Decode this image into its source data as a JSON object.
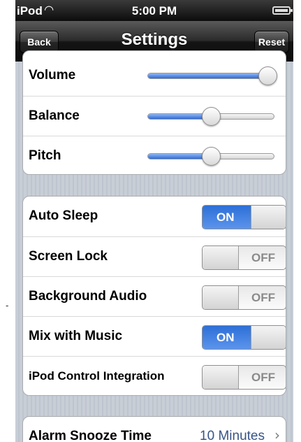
{
  "statusbar": {
    "carrier": "iPod",
    "time": "5:00 PM",
    "wifi_icon": "wifi-icon",
    "battery_icon": "battery-icon"
  },
  "navbar": {
    "title": "Settings",
    "back_label": "Back",
    "reset_label": "Reset"
  },
  "outside_mark": "-",
  "sliders": [
    {
      "label": "Volume",
      "value": 0.95
    },
    {
      "label": "Balance",
      "value": 0.5
    },
    {
      "label": "Pitch",
      "value": 0.5
    }
  ],
  "switches": [
    {
      "label": "Auto Sleep",
      "state": "ON"
    },
    {
      "label": "Screen Lock",
      "state": "OFF"
    },
    {
      "label": "Background Audio",
      "state": "OFF"
    },
    {
      "label": "Mix with Music",
      "state": "ON"
    },
    {
      "label": "iPod Control Integration",
      "state": "OFF"
    }
  ],
  "alarm": {
    "label": "Alarm Snooze Time",
    "value": "10 Minutes",
    "chevron": "›"
  },
  "colors": {
    "switch_on": "#2d6fd7",
    "detail_value": "#385487"
  }
}
